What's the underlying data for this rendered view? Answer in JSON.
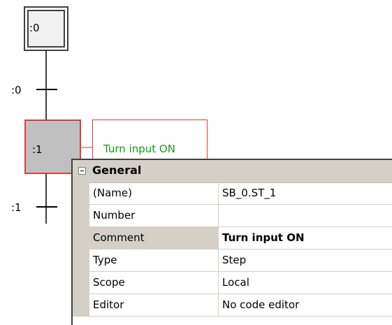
{
  "sfc": {
    "initial_step_label": ":0",
    "transition_0_label": ":0",
    "active_step_label": ":1",
    "transition_1_label": ":1",
    "action_comment": "Turn input ON",
    "colors": {
      "active_border": "#e03c3c",
      "active_fill": "#c0c0c0",
      "comment_text": "#1a9a1a",
      "line": "#000000"
    }
  },
  "properties": {
    "group_label": "General",
    "rows": [
      {
        "name": "(Name)",
        "value": "SB_0.ST_1"
      },
      {
        "name": "Number",
        "value": ""
      },
      {
        "name": "Comment",
        "value": "Turn input ON"
      },
      {
        "name": "Type",
        "value": "Step"
      },
      {
        "name": "Scope",
        "value": "Local"
      },
      {
        "name": "Editor",
        "value": "No code editor"
      }
    ],
    "selected_row": "Comment",
    "colors": {
      "header_bg": "#d4d0c8",
      "grid_line": "#d4d0c8"
    }
  }
}
